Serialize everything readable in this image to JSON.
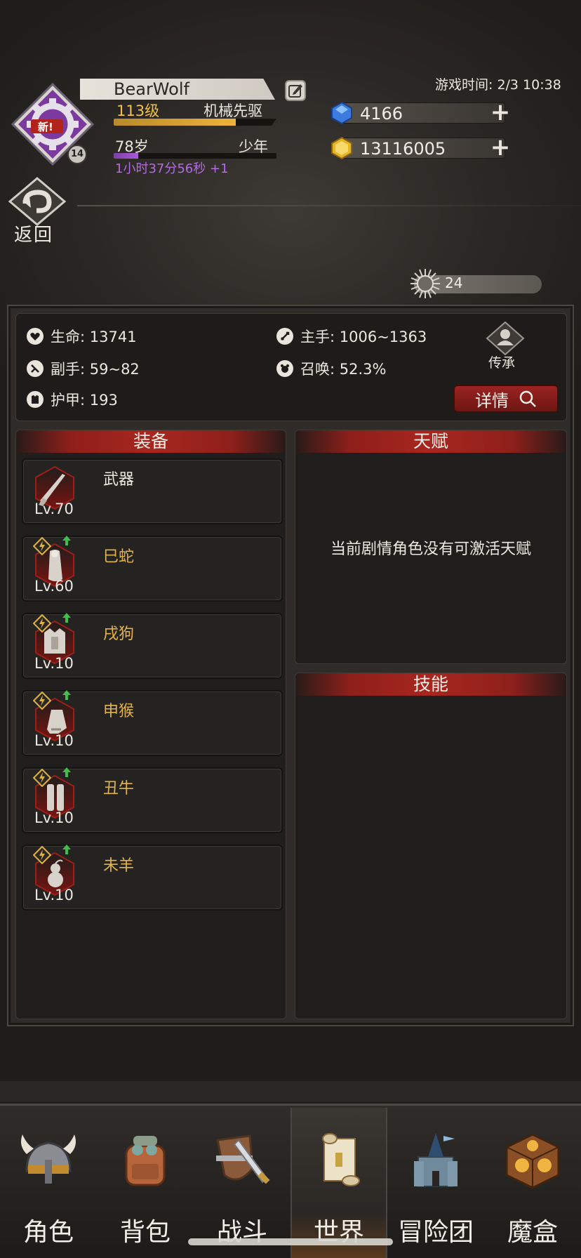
{
  "player": {
    "name": "BearWolf",
    "level_text": "113级",
    "class_name": "机械先驱",
    "level_progress": 0.75,
    "age_text": "78岁",
    "stage_text": "少年",
    "age_progress": 0.15,
    "timer_text": "1小时37分56秒 +1",
    "badge_new": "新!",
    "badge_number": "14"
  },
  "game_time": "游戏时间: 2/3 10:38",
  "resources": {
    "gems": "4166",
    "gold": "13116005"
  },
  "back_label": "返回",
  "sun_counter": "24",
  "stats": {
    "hp": "生命: 13741",
    "main_hand": "主手: 1006~1363",
    "off_hand": "副手: 59~82",
    "summon": "召唤: 52.3%",
    "armor": "护甲: 193",
    "inherit_label": "传承",
    "detail_label": "详情"
  },
  "sections": {
    "equipment": "装备",
    "talent": "天赋",
    "skills": "技能"
  },
  "talent_message": "当前剧情角色没有可激活天赋",
  "equipment": [
    {
      "name": "武器",
      "level": "Lv.70",
      "icon": "rifle-icon",
      "name_color": "#ece8e0",
      "ranked": false
    },
    {
      "name": "巳蛇",
      "level": "Lv.60",
      "icon": "cloak-icon",
      "name_color": "#e4b24a",
      "ranked": true
    },
    {
      "name": "戌狗",
      "level": "Lv.10",
      "icon": "armor-icon",
      "name_color": "#e4b24a",
      "ranked": true
    },
    {
      "name": "申猴",
      "level": "Lv.10",
      "icon": "gauntlet-icon",
      "name_color": "#e4b24a",
      "ranked": true
    },
    {
      "name": "丑牛",
      "level": "Lv.10",
      "icon": "greaves-icon",
      "name_color": "#e4b24a",
      "ranked": true
    },
    {
      "name": "未羊",
      "level": "Lv.10",
      "icon": "gourd-icon",
      "name_color": "#e4b24a",
      "ranked": true
    }
  ],
  "nav": [
    {
      "label": "角色",
      "icon": "helmet-icon"
    },
    {
      "label": "背包",
      "icon": "backpack-icon"
    },
    {
      "label": "战斗",
      "icon": "shield-sword-icon"
    },
    {
      "label": "世界",
      "icon": "scroll-icon",
      "active": true
    },
    {
      "label": "冒险团",
      "icon": "castle-icon"
    },
    {
      "label": "魔盒",
      "icon": "magic-box-icon"
    }
  ]
}
